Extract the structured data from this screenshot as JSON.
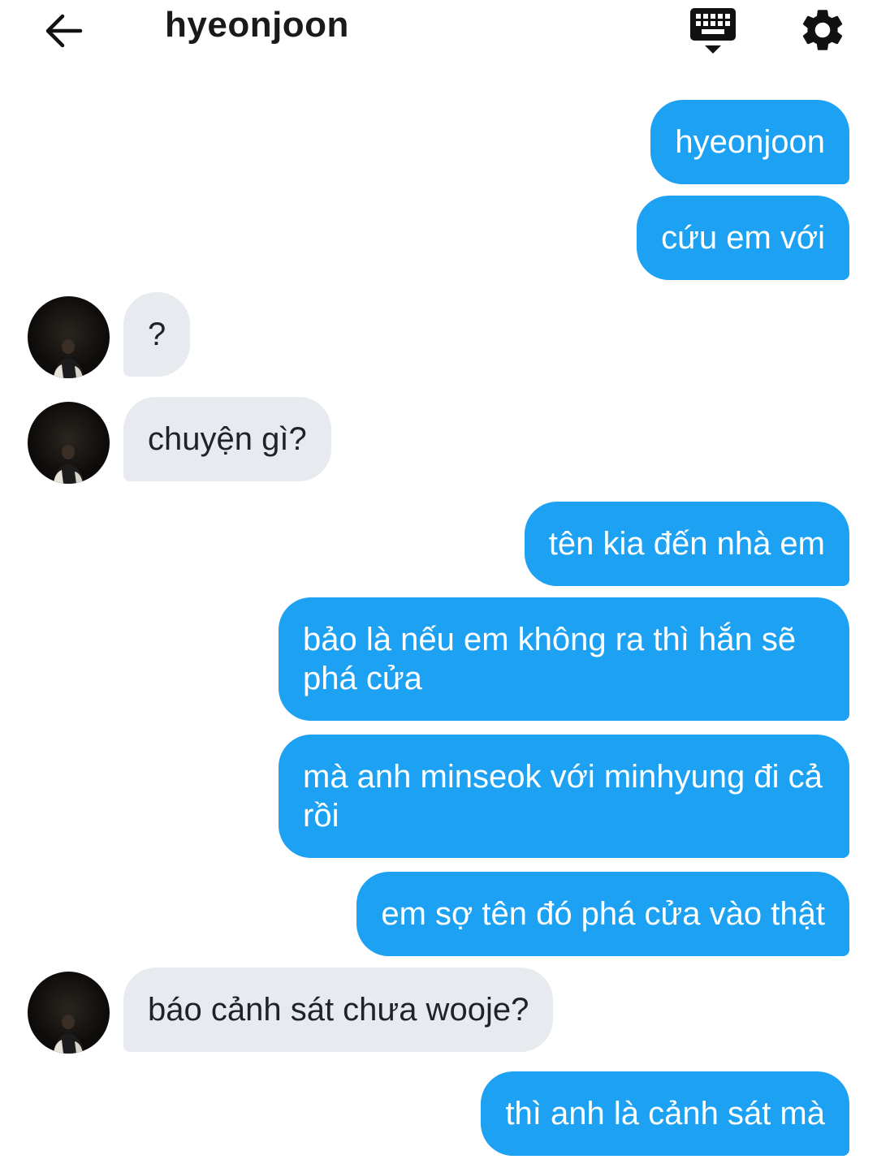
{
  "header": {
    "back_icon": "arrow-left-icon",
    "title": "hyeonjoon",
    "keyboard_icon": "keyboard-hide-icon",
    "settings_icon": "gear-icon"
  },
  "colors": {
    "outgoing_bubble": "#1da1f2",
    "incoming_bubble": "#e7ebf0"
  },
  "messages": [
    {
      "direction": "out",
      "text": "hyeonjoon"
    },
    {
      "direction": "out",
      "text": "cứu em với"
    },
    {
      "direction": "in",
      "text": "?"
    },
    {
      "direction": "in",
      "text": "chuyện gì?"
    },
    {
      "direction": "out",
      "text": "tên kia đến nhà em"
    },
    {
      "direction": "out",
      "text": "bảo là nếu em không ra thì hắn sẽ phá cửa"
    },
    {
      "direction": "out",
      "text": "mà anh minseok với minhyung đi cả rồi"
    },
    {
      "direction": "out",
      "text": "em sợ tên đó phá cửa vào thật"
    },
    {
      "direction": "in",
      "text": "báo cảnh sát chưa wooje?"
    },
    {
      "direction": "out",
      "text": "thì anh là cảnh sát mà"
    }
  ]
}
